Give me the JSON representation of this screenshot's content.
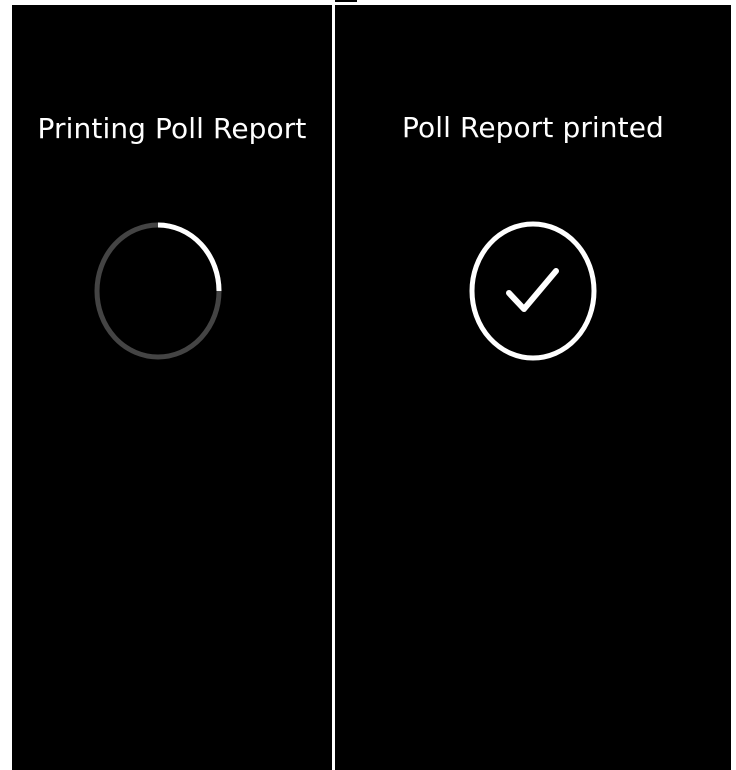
{
  "screens": [
    {
      "id": "printing",
      "title": "Printing Poll Report",
      "status": "in-progress",
      "indicator_icon": "loading-spinner-icon",
      "progress_fraction": 0.25
    },
    {
      "id": "printed",
      "title": "Poll Report printed",
      "status": "complete",
      "indicator_icon": "checkmark-circle-icon"
    }
  ],
  "colors": {
    "background": "#000000",
    "text": "#ffffff",
    "spinner_track": "#444444",
    "spinner_active": "#ffffff",
    "divider": "#ffffff"
  }
}
